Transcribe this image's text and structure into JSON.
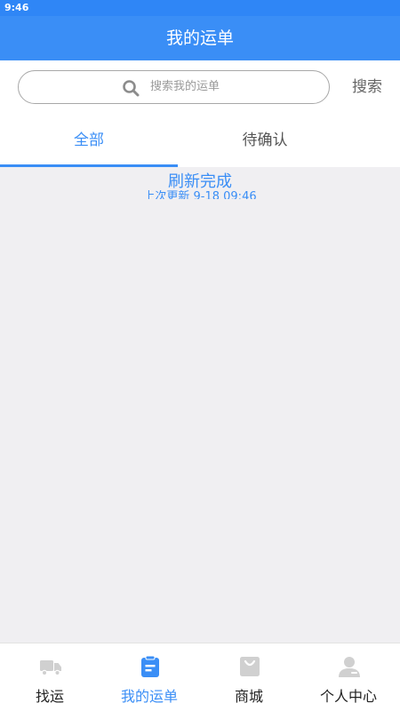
{
  "status_bar": {
    "time": "9:46"
  },
  "header": {
    "title": "我的运单"
  },
  "search": {
    "placeholder": "搜索我的运单",
    "button_label": "搜索"
  },
  "tabs": [
    {
      "label": "全部",
      "active": true
    },
    {
      "label": "待确认",
      "active": false
    }
  ],
  "refresh": {
    "title": "刷新完成",
    "last_update": "上次更新 9-18 09:46"
  },
  "bottom_nav": [
    {
      "label": "找运",
      "icon": "truck-icon",
      "active": false
    },
    {
      "label": "我的运单",
      "icon": "clipboard-icon",
      "active": true
    },
    {
      "label": "商城",
      "icon": "shopping-bag-icon",
      "active": false
    },
    {
      "label": "个人中心",
      "icon": "person-icon",
      "active": false
    }
  ],
  "colors": {
    "primary": "#3a8ef6",
    "status_bar": "#2f86f6",
    "background": "#f0eff2",
    "icon_inactive": "#d0d0d0"
  }
}
